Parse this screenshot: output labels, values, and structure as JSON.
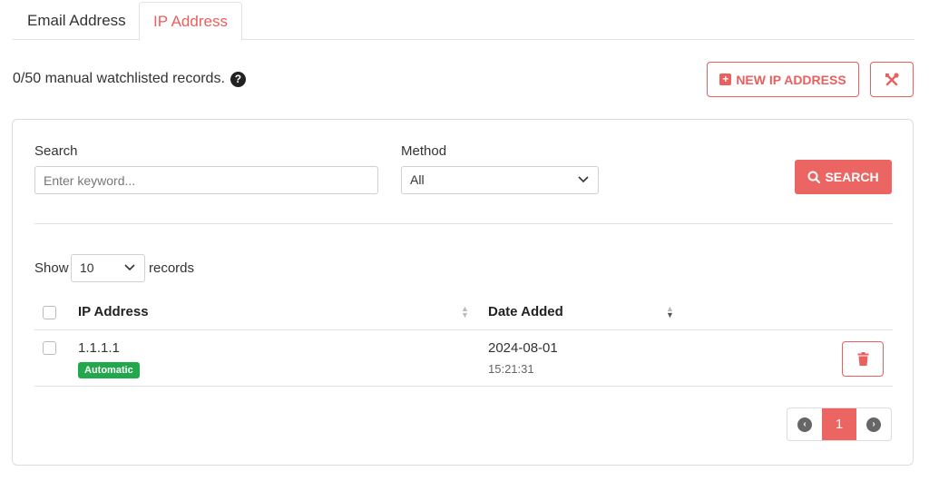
{
  "tabs": [
    {
      "label": "Email Address"
    },
    {
      "label": "IP Address"
    }
  ],
  "summary": {
    "text": "0/50 manual watchlisted records.",
    "help_icon": "?"
  },
  "buttons": {
    "new_ip": "NEW IP ADDRESS",
    "search": "SEARCH"
  },
  "filters": {
    "search_label": "Search",
    "search_placeholder": "Enter keyword...",
    "method_label": "Method",
    "method_value": "All"
  },
  "records": {
    "show_label": "Show",
    "page_size": "10",
    "records_label": "records"
  },
  "table": {
    "columns": [
      "IP Address",
      "Date Added"
    ],
    "rows": [
      {
        "ip": "1.1.1.1",
        "badge": "Automatic",
        "date": "2024-08-01",
        "time": "15:21:31"
      }
    ]
  },
  "pagination": {
    "current": "1"
  },
  "colors": {
    "accent": "#eb5f5d",
    "badge": "#22a84b"
  }
}
